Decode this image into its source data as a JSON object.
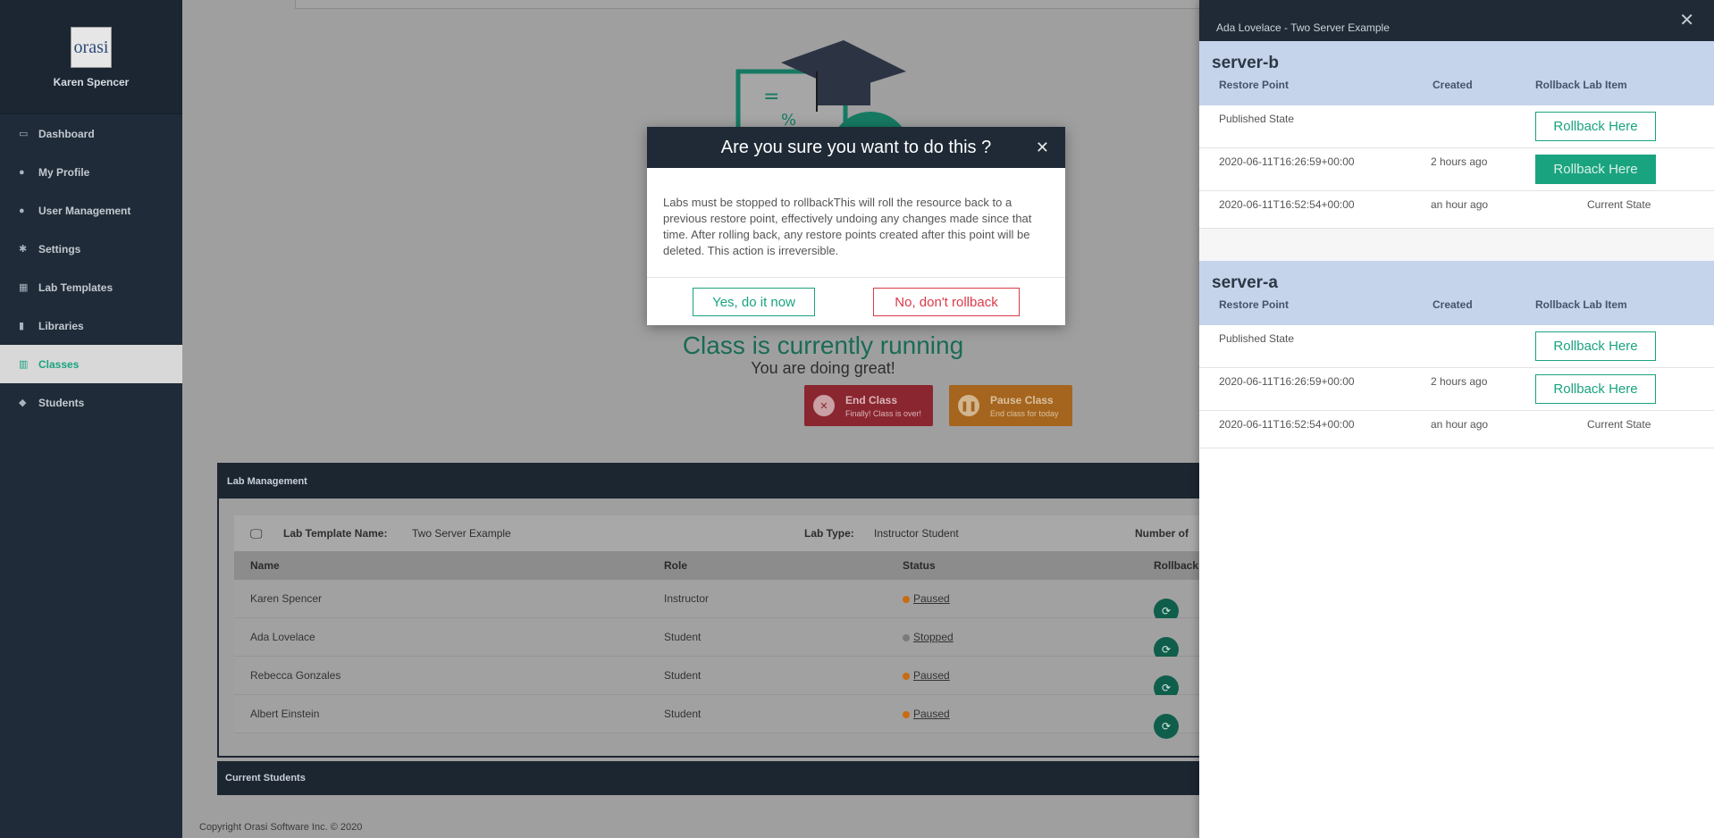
{
  "sidebar": {
    "user_name": "Karen Spencer",
    "logo_text": "orasi",
    "items": [
      {
        "label": "Dashboard",
        "icon": "monitor-icon"
      },
      {
        "label": "My Profile",
        "icon": "user-icon"
      },
      {
        "label": "User Management",
        "icon": "users-icon"
      },
      {
        "label": "Settings",
        "icon": "gear-icon"
      },
      {
        "label": "Lab Templates",
        "icon": "cubes-icon"
      },
      {
        "label": "Libraries",
        "icon": "book-icon"
      },
      {
        "label": "Classes",
        "icon": "bank-icon",
        "active": true
      },
      {
        "label": "Students",
        "icon": "graduation-cap-icon"
      }
    ]
  },
  "main": {
    "running_text": "Class is currently running",
    "great_text": "You are doing great!",
    "end_class": {
      "title": "End Class",
      "subtitle": "Finally! Class is over!"
    },
    "pause_class": {
      "title": "Pause Class",
      "subtitle": "End class for today"
    },
    "lab_management": {
      "header": "Lab Management",
      "template_name_label": "Lab Template Name:",
      "template_name_value": "Two Server Example",
      "lab_type_label": "Lab Type:",
      "lab_type_value": "Instructor Student",
      "number_label": "Number of",
      "columns": [
        "Name",
        "Role",
        "Status",
        "Rollback"
      ],
      "rows": [
        {
          "name": "Karen Spencer",
          "role": "Instructor",
          "status": "Paused",
          "status_color": "#c96b12"
        },
        {
          "name": "Ada Lovelace",
          "role": "Student",
          "status": "Stopped",
          "status_color": "#7a7a7a"
        },
        {
          "name": "Rebecca Gonzales",
          "role": "Student",
          "status": "Paused",
          "status_color": "#c96b12"
        },
        {
          "name": "Albert Einstein",
          "role": "Student",
          "status": "Paused",
          "status_color": "#c96b12"
        }
      ]
    },
    "current_students": "Current Students",
    "copyright": "Copyright Orasi Software Inc. © 2020"
  },
  "right_panel": {
    "title": "Ada Lovelace - Two Server Example",
    "columns": [
      "Restore Point",
      "Created",
      "Rollback Lab Item"
    ],
    "servers": [
      {
        "name": "server-b",
        "rows": [
          {
            "restore_point": "Published State",
            "created": "",
            "action": "Rollback Here",
            "filled": false
          },
          {
            "restore_point": "2020-06-11T16:26:59+00:00",
            "created": "2 hours ago",
            "action": "Rollback Here",
            "filled": true
          },
          {
            "restore_point": "2020-06-11T16:52:54+00:00",
            "created": "an hour ago",
            "action": "Current State"
          }
        ]
      },
      {
        "name": "server-a",
        "rows": [
          {
            "restore_point": "Published State",
            "created": "",
            "action": "Rollback Here",
            "filled": false
          },
          {
            "restore_point": "2020-06-11T16:26:59+00:00",
            "created": "2 hours ago",
            "action": "Rollback Here",
            "filled": false
          },
          {
            "restore_point": "2020-06-11T16:52:54+00:00",
            "created": "an hour ago",
            "action": "Current State"
          }
        ]
      }
    ]
  },
  "modal": {
    "title": "Are you sure you want to do this ?",
    "body": "Labs must be stopped to rollbackThis will roll the resource back to a previous restore point, effectively undoing any changes made since that time. After rolling back, any restore points created after this point will be deleted. This action is irreversible.",
    "yes_label": "Yes, do it now",
    "no_label": "No, don't rollback"
  },
  "colors": {
    "accent": "#1aa37f",
    "danger": "#d93a49",
    "navy": "#1f2a36"
  }
}
